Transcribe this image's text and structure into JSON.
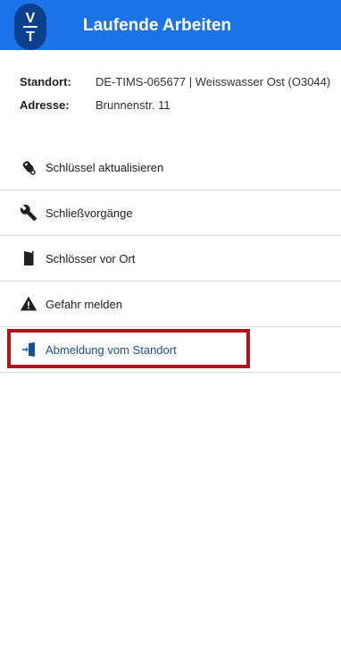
{
  "header": {
    "logo_text": "VT",
    "title": "Laufende Arbeiten",
    "background_color": "#1a73e8"
  },
  "location": {
    "standort_label": "Standort:",
    "standort_value": "DE-TIMS-065677 | Weisswasser Ost (O3044)",
    "adresse_label": "Adresse:",
    "adresse_value": "Brunnenstr. 11"
  },
  "menu": {
    "items": [
      {
        "label": "Schlüssel aktualisieren",
        "icon": "key-fob-icon"
      },
      {
        "label": "Schließvorgänge",
        "icon": "wrench-icon"
      },
      {
        "label": "Schlösser vor Ort",
        "icon": "door-icon"
      },
      {
        "label": "Gefahr melden",
        "icon": "warning-icon"
      },
      {
        "label": "Abmeldung vom Standort",
        "icon": "logout-icon",
        "highlighted": true,
        "accent_color": "#1c4f8c"
      }
    ]
  },
  "highlight_color": "#b5121b"
}
